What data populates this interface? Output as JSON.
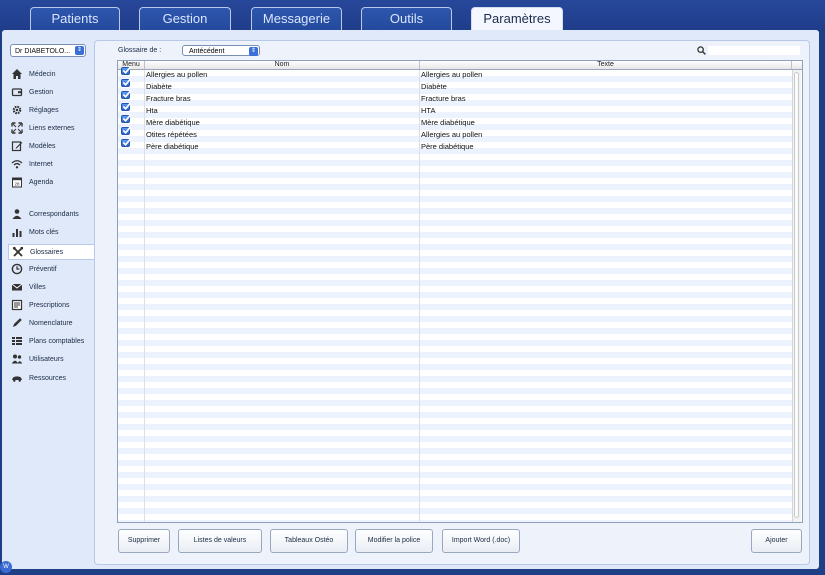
{
  "tabs": [
    {
      "label": "Patients"
    },
    {
      "label": "Gestion"
    },
    {
      "label": "Messagerie"
    },
    {
      "label": "Outils"
    },
    {
      "label": "Paramètres",
      "active": true
    }
  ],
  "sidebar": {
    "doctor_select": "Dr DIABETOLO...",
    "items": [
      {
        "label": "Médecin",
        "icon": "house-icon"
      },
      {
        "label": "Gestion",
        "icon": "wallet-icon"
      },
      {
        "label": "Réglages",
        "icon": "gear-icon"
      },
      {
        "label": "Liens externes",
        "icon": "expand-icon"
      },
      {
        "label": "Modèles",
        "icon": "pencil-square-icon"
      },
      {
        "label": "Internet",
        "icon": "wifi-icon"
      },
      {
        "label": "Agenda",
        "icon": "calendar-icon"
      },
      {
        "label": "Correspondants",
        "icon": "person-icon"
      },
      {
        "label": "Mots clés",
        "icon": "bar-chart-icon"
      },
      {
        "label": "Glossaires",
        "icon": "tools-icon",
        "active": true
      },
      {
        "label": "Préventif",
        "icon": "clock-icon"
      },
      {
        "label": "Villes",
        "icon": "envelope-icon"
      },
      {
        "label": "Prescriptions",
        "icon": "document-icon"
      },
      {
        "label": "Nomenclature",
        "icon": "pen-icon"
      },
      {
        "label": "Plans comptables",
        "icon": "list-icon"
      },
      {
        "label": "Utilisateurs",
        "icon": "users-icon"
      },
      {
        "label": "Ressources",
        "icon": "car-icon"
      }
    ]
  },
  "glossary": {
    "label": "Glossaire de :",
    "selected": "Antécédent"
  },
  "search": {
    "value": "",
    "placeholder": ""
  },
  "table": {
    "headers": {
      "menu": "Menu",
      "nom": "Nom",
      "texte": "Texte"
    },
    "rows": [
      {
        "checked": true,
        "nom": "Allergies au pollen",
        "texte": "Allergies au pollen"
      },
      {
        "checked": true,
        "nom": "Diabète",
        "texte": "Diabète"
      },
      {
        "checked": true,
        "nom": "Fracture bras",
        "texte": "Fracture bras"
      },
      {
        "checked": true,
        "nom": "Hta",
        "texte": "HTA"
      },
      {
        "checked": true,
        "nom": "Mère diabétique",
        "texte": "Mère diabétique"
      },
      {
        "checked": true,
        "nom": "Otites répétées",
        "texte": "Allergies au pollen"
      },
      {
        "checked": true,
        "nom": "Père diabétique",
        "texte": "Père diabétique"
      }
    ]
  },
  "buttons": {
    "supprimer": "Supprimer",
    "listes": "Listes de valeurs",
    "tableaux": "Tableaux Ostéo",
    "police": "Modifier la police",
    "import": "Import Word (.doc)",
    "ajouter": "Ajouter"
  },
  "corner_badge": "W",
  "colors": {
    "background": "#1e3f86",
    "panel": "#dfe9f9",
    "accent": "#2a64c8"
  }
}
